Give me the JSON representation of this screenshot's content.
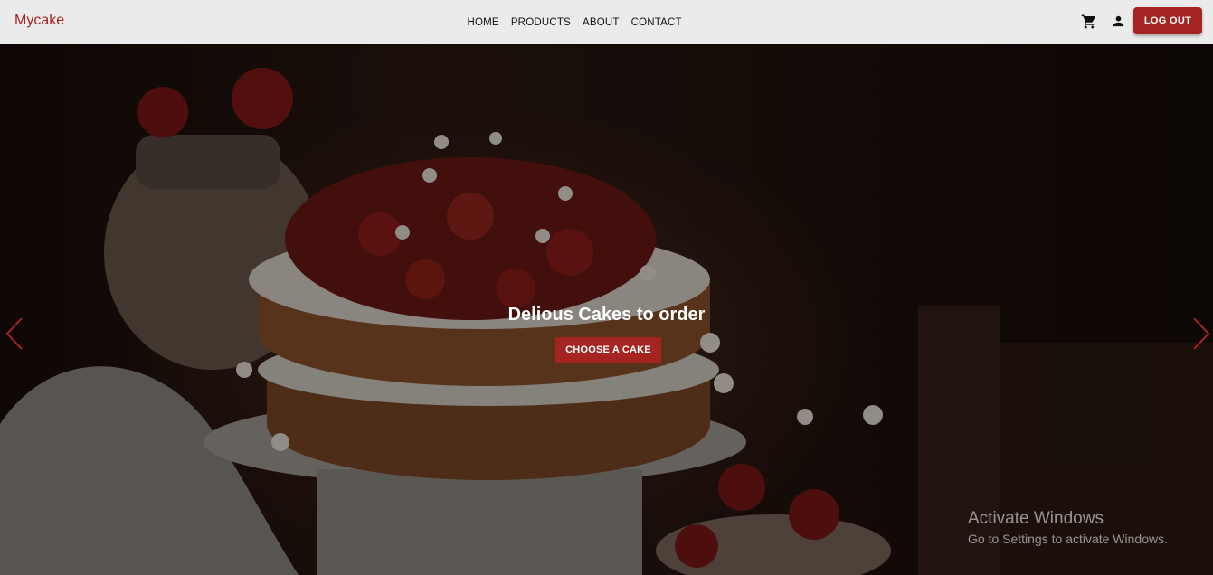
{
  "brand": {
    "name": "Mycake",
    "color": "#a52422"
  },
  "nav": {
    "links": [
      {
        "label": "HOME"
      },
      {
        "label": "PRODUCTS"
      },
      {
        "label": "ABOUT"
      },
      {
        "label": "CONTACT"
      }
    ]
  },
  "header_actions": {
    "cart_icon": "shopping-cart-icon",
    "user_icon": "person-icon",
    "logout_label": "LOG OUT"
  },
  "hero": {
    "caption": "Delious Cakes to order",
    "cta_label": "CHOOSE A CAKE",
    "prev_icon": "chevron-left-icon",
    "next_icon": "chevron-right-icon",
    "accent_color": "#a52422"
  },
  "watermark": {
    "title": "Activate Windows",
    "subtitle": "Go to Settings to activate Windows."
  }
}
